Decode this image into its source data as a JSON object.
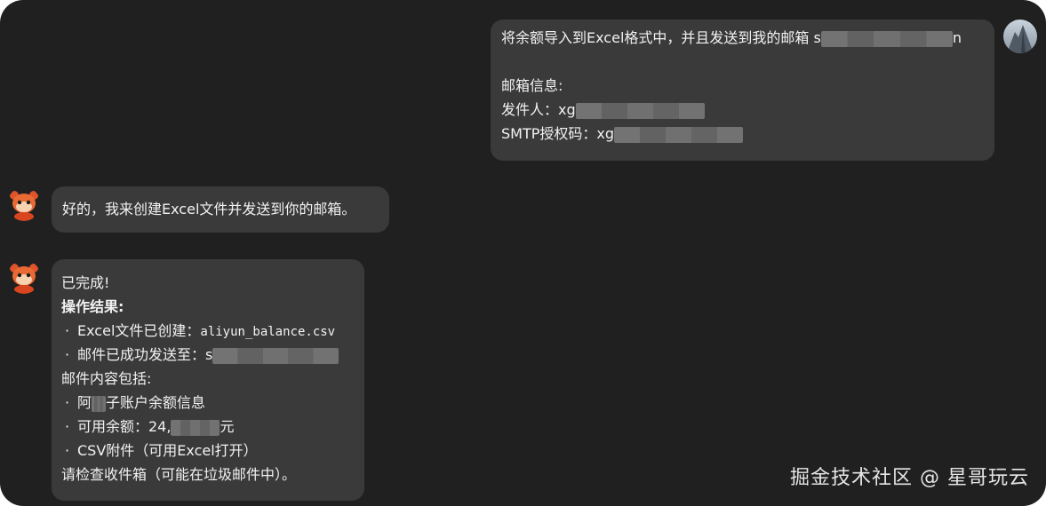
{
  "user_message": {
    "line1_prefix": "将余额导入到Excel格式中，并且发送到我的邮箱 s",
    "line1_suffix": "n",
    "line3": "邮箱信息:",
    "line4_prefix": "发件人：xg",
    "line5_prefix": "SMTP授权码：xg"
  },
  "assistant_message_1": {
    "text": "好的，我来创建Excel文件并发送到你的邮箱。"
  },
  "assistant_message_2": {
    "done": "已完成!",
    "result_title": "操作结果:",
    "item1_label": "Excel文件已创建：",
    "item1_file": "aliyun_balance.csv",
    "item2_label": "邮件已成功发送至：s",
    "content_title": "邮件内容包括:",
    "item3_prefix": "阿",
    "item3_suffix": "子账户余额信息",
    "item4_prefix": "可用余额：24,",
    "item4_suffix": "元",
    "item5": "CSV附件（可用Excel打开）",
    "closing": "请检查收件箱（可能在垃圾邮件中）。",
    "bullet": "·"
  },
  "watermark": "掘金技术社区 @ 星哥玩云",
  "colors": {
    "background": "#202020",
    "bubble": "#3a3a3a",
    "text": "#f2f2f2",
    "redaction": "#6a6a6a"
  }
}
